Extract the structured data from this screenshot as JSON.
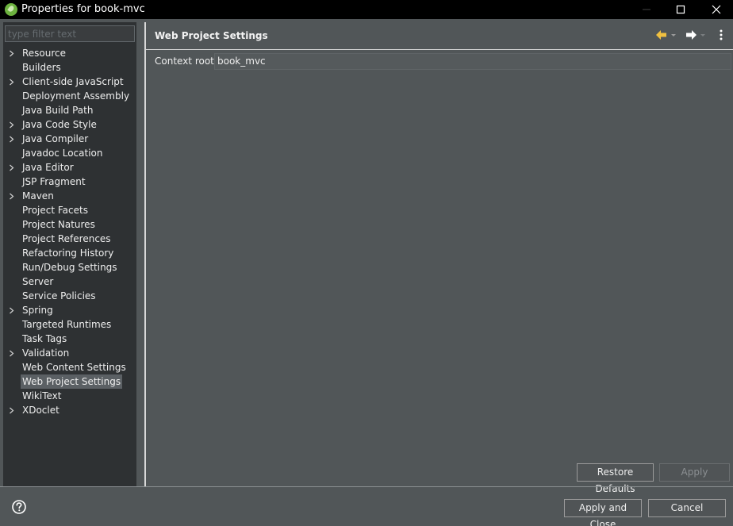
{
  "window": {
    "title": "Properties for book-mvc",
    "app_icon": "spring-leaf-icon",
    "controls": [
      "minimize-icon",
      "maximize-icon",
      "close-icon"
    ]
  },
  "sidebar": {
    "filter_placeholder": "type filter text",
    "items": [
      {
        "label": "Resource",
        "expandable": true
      },
      {
        "label": "Builders",
        "expandable": false
      },
      {
        "label": "Client-side JavaScript",
        "expandable": true
      },
      {
        "label": "Deployment Assembly",
        "expandable": false
      },
      {
        "label": "Java Build Path",
        "expandable": false
      },
      {
        "label": "Java Code Style",
        "expandable": true
      },
      {
        "label": "Java Compiler",
        "expandable": true
      },
      {
        "label": "Javadoc Location",
        "expandable": false
      },
      {
        "label": "Java Editor",
        "expandable": true
      },
      {
        "label": "JSP Fragment",
        "expandable": false
      },
      {
        "label": "Maven",
        "expandable": true
      },
      {
        "label": "Project Facets",
        "expandable": false
      },
      {
        "label": "Project Natures",
        "expandable": false
      },
      {
        "label": "Project References",
        "expandable": false
      },
      {
        "label": "Refactoring History",
        "expandable": false
      },
      {
        "label": "Run/Debug Settings",
        "expandable": false
      },
      {
        "label": "Server",
        "expandable": false
      },
      {
        "label": "Service Policies",
        "expandable": false
      },
      {
        "label": "Spring",
        "expandable": true
      },
      {
        "label": "Targeted Runtimes",
        "expandable": false
      },
      {
        "label": "Task Tags",
        "expandable": false
      },
      {
        "label": "Validation",
        "expandable": true
      },
      {
        "label": "Web Content Settings",
        "expandable": false
      },
      {
        "label": "Web Project Settings",
        "expandable": false,
        "selected": true
      },
      {
        "label": "WikiText",
        "expandable": false
      },
      {
        "label": "XDoclet",
        "expandable": true
      }
    ]
  },
  "page": {
    "title": "Web Project Settings",
    "nav_icons": [
      "back-arrow-icon",
      "forward-arrow-icon",
      "view-menu-icon"
    ],
    "context_root_label": "Context root:",
    "context_root_value": "book_mvc"
  },
  "buttons": {
    "restore_defaults": "Restore Defaults",
    "apply": "Apply",
    "apply_and_close": "Apply and Close",
    "cancel": "Cancel"
  },
  "colors": {
    "background": "#515658",
    "sidebar": "#2e3133",
    "selection": "#5b6064",
    "back_arrow": "#f0c040"
  }
}
